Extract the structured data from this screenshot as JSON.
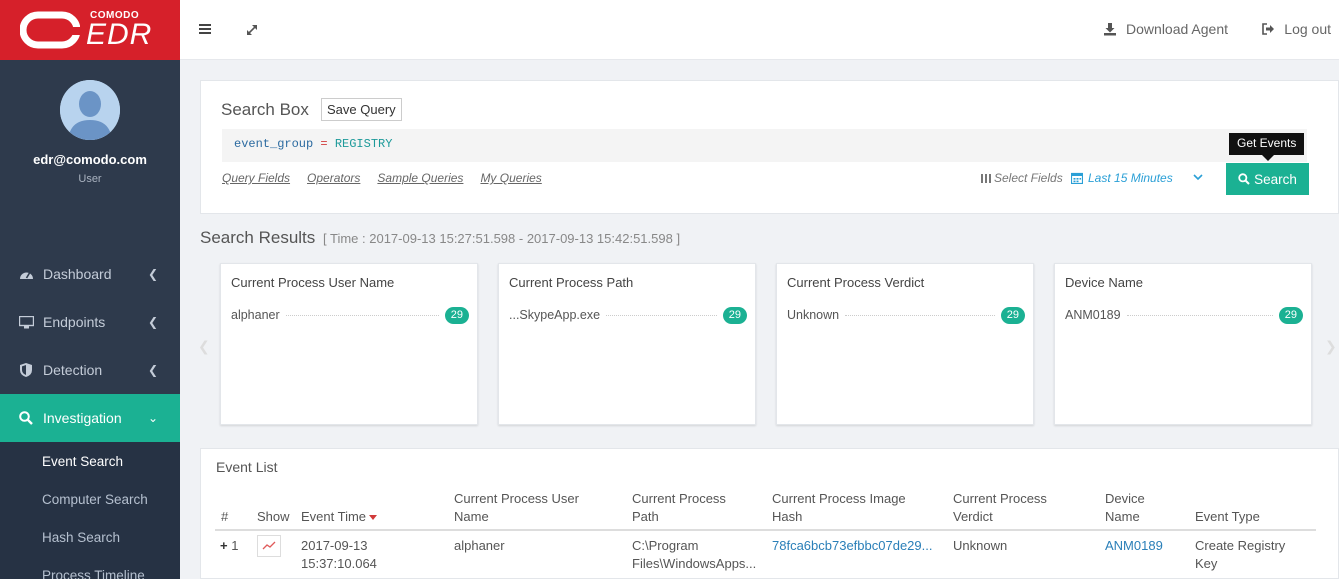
{
  "brand": {
    "small": "COMODO",
    "big": "EDR"
  },
  "user": {
    "email": "edr@comodo.com",
    "role": "User"
  },
  "nav": {
    "items": [
      {
        "label": "Dashboard"
      },
      {
        "label": "Endpoints"
      },
      {
        "label": "Detection"
      },
      {
        "label": "Investigation"
      }
    ],
    "sub_items": [
      {
        "label": "Event Search"
      },
      {
        "label": "Computer Search"
      },
      {
        "label": "Hash Search"
      },
      {
        "label": "Process Timeline"
      }
    ]
  },
  "topbar": {
    "download_label": "Download Agent",
    "logout_label": "Log out"
  },
  "search_box": {
    "title": "Search Box",
    "save_label": "Save Query",
    "query_field": "event_group",
    "query_op": "=",
    "query_value": "REGISTRY",
    "links": [
      "Query Fields",
      "Operators",
      "Sample Queries",
      "My Queries"
    ],
    "select_fields": "Select Fields",
    "time_range": "Last 15 Minutes",
    "search_label": "Search",
    "tooltip": "Get Events"
  },
  "results": {
    "title": "Search Results",
    "time_text": "[ Time : 2017-09-13 15:27:51.598 - 2017-09-13 15:42:51.598 ]",
    "cards": [
      {
        "title": "Current Process User Name",
        "value": "alphaner",
        "count": "29"
      },
      {
        "title": "Current Process Path",
        "value": "...SkypeApp.exe",
        "count": "29"
      },
      {
        "title": "Current Process Verdict",
        "value": "Unknown",
        "count": "29"
      },
      {
        "title": "Device Name",
        "value": "ANM0189",
        "count": "29"
      }
    ]
  },
  "event_list": {
    "title": "Event List",
    "headers": {
      "num": "#",
      "show": "Show",
      "time": "Event Time",
      "user_1": "Current Process User",
      "user_2": "Name",
      "path_1": "Current Process",
      "path_2": "Path",
      "hash_1": "Current Process Image",
      "hash_2": "Hash",
      "verdict_1": "Current Process",
      "verdict_2": "Verdict",
      "device_1": "Device",
      "device_2": "Name",
      "type": "Event Type"
    },
    "row": {
      "plus": "+",
      "num": "1",
      "time_1": "2017-09-13",
      "time_2": "15:37:10.064",
      "user": "alphaner",
      "path_1": "C:\\Program",
      "path_2": "Files\\WindowsApps...",
      "hash": "78fca6bcb73efbbc07de29...",
      "verdict": "Unknown",
      "device": "ANM0189",
      "type_1": "Create Registry",
      "type_2": "Key"
    }
  },
  "colors": {
    "brand_red": "#d6202a",
    "accent_teal": "#1bb193",
    "sidebar_bg": "#2e3a4c",
    "link_blue": "#2a7fb8"
  }
}
